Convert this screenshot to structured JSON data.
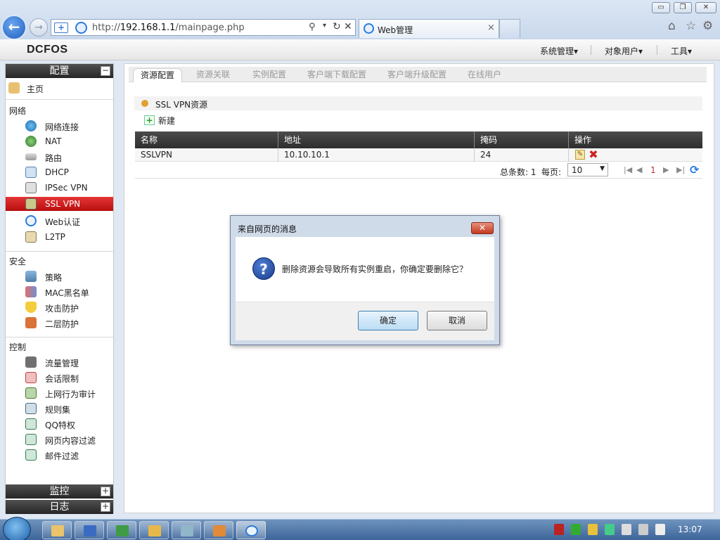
{
  "browser": {
    "url_prefix": "http://",
    "url_host": "192.168.1.1",
    "url_path": "/mainpage.php",
    "tab_title": "Web管理",
    "tab_close": "×",
    "window_minimize": "▭",
    "window_restore": "❐",
    "window_close": "✕",
    "back_icon": "←",
    "forward_icon": "→",
    "tools_icons": [
      "home-icon",
      "favorites-star-icon",
      "settings-gear-icon"
    ]
  },
  "app": {
    "logo": "DCFOS",
    "top_menu": [
      "系统管理▾",
      "对象用户▾",
      "工具▾"
    ]
  },
  "sidebar": {
    "config_header": "配置",
    "config_toggle": "−",
    "home": "主页",
    "groups": [
      {
        "title": "网络",
        "items": [
          "网络连接",
          "NAT",
          "路由",
          "DHCP",
          "IPSec VPN",
          "SSL VPN",
          "Web认证",
          "L2TP"
        ]
      },
      {
        "title": "安全",
        "items": [
          "策略",
          "MAC黑名单",
          "攻击防护",
          "二层防护"
        ]
      },
      {
        "title": "控制",
        "items": [
          "流量管理",
          "会话限制",
          "上网行为审计",
          "规则集",
          "QQ特权",
          "网页内容过滤",
          "邮件过滤"
        ]
      }
    ],
    "active_item": "SSL VPN",
    "monitor_header": "监控",
    "log_header": "日志",
    "expand_symbol": "+"
  },
  "main": {
    "tabs": [
      "资源配置",
      "资源关联",
      "实例配置",
      "客户端下载配置",
      "客户端升级配置",
      "在线用户"
    ],
    "active_tab": "资源配置",
    "section_title": "SSL VPN资源",
    "new_button": "新建",
    "new_icon": "+",
    "table": {
      "headers": [
        "名称",
        "地址",
        "掩码",
        "操作"
      ],
      "rows": [
        [
          "SSLVPN",
          "10.10.10.1",
          "24"
        ]
      ]
    },
    "edit_icon": "✎",
    "delete_icon": "✖",
    "pager": {
      "total_label": "总条数: 1",
      "per_page_label": "每页:",
      "per_page_value": "10",
      "dropdown_arrow": "▼",
      "current_page": "1",
      "first": "|◀",
      "prev": "◀",
      "next": "▶",
      "last": "▶|",
      "refresh": "⟳"
    }
  },
  "dialog": {
    "title": "来自网页的消息",
    "close": "✕",
    "question_icon": "?",
    "message": "删除资源会导致所有实例重启，你确定要删除它？",
    "ok": "确定",
    "cancel": "取消"
  },
  "taskbar": {
    "clock": "13:07"
  },
  "colors": {
    "active_nav": "#c81818",
    "header_dark": "#2e2e2e",
    "section_dot": "#e0a030"
  }
}
